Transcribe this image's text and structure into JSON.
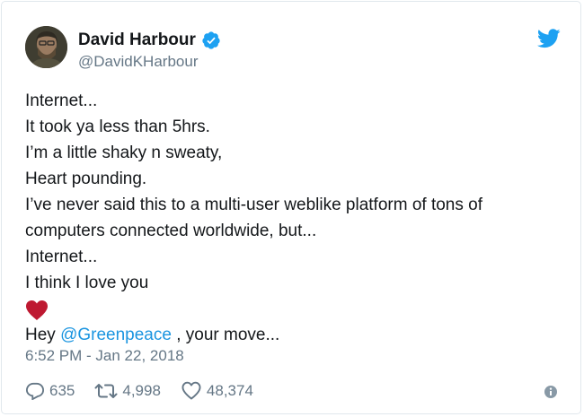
{
  "tweet": {
    "author": {
      "display_name": "David Harbour",
      "handle": "@DavidKHarbour",
      "verified": true
    },
    "text_lines": [
      "Internet...",
      "It took ya less than 5hrs.",
      "I’m a little shaky n sweaty,",
      "Heart pounding.",
      "I’ve never said this to a multi-user weblike platform of tons of",
      "computers connected worldwide, but...",
      "Internet...",
      "I think I love you"
    ],
    "emoji": "red-heart",
    "last_line": {
      "prefix": "Hey ",
      "mention": "@Greenpeace",
      "suffix": " , your move..."
    },
    "timestamp": "6:52 PM - Jan 22, 2018",
    "stats": {
      "replies": "635",
      "retweets": "4,998",
      "likes": "48,374"
    }
  },
  "icons": {
    "verified": "verified-badge-icon",
    "brand": "twitter-bird-icon",
    "reply": "reply-icon",
    "retweet": "retweet-icon",
    "like": "heart-icon",
    "info": "info-icon"
  },
  "colors": {
    "brand_blue": "#1da1f2",
    "link_blue": "#1b95e0",
    "text": "#14171a",
    "muted": "#657786",
    "heart_red": "#be1931"
  }
}
